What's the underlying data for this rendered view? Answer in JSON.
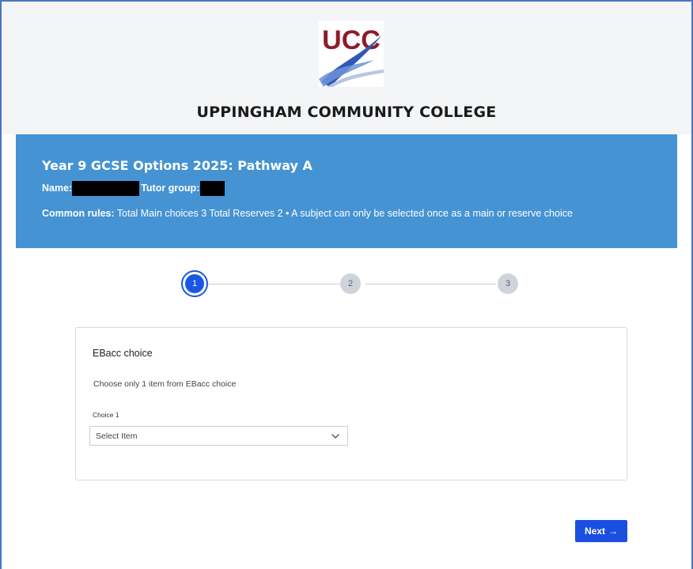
{
  "header": {
    "logo_text": "UCC",
    "college_name": "UPPINGHAM COMMUNITY COLLEGE"
  },
  "banner": {
    "title": "Year 9 GCSE Options 2025: Pathway A",
    "name_label": "Name:",
    "tutor_label": "Tutor group:",
    "rules_label": "Common rules:",
    "rules_text": " Total Main choices 3 Total Reserves 2 • A subject can only be selected once as a main or reserve choice"
  },
  "stepper": {
    "steps": [
      "1",
      "2",
      "3"
    ],
    "current": 1
  },
  "card": {
    "title": "EBacc choice",
    "help_text": "Choose only 1 item from EBacc choice",
    "field_label": "Choice 1",
    "select_value": "Select Item"
  },
  "actions": {
    "next_label": "Next",
    "next_icon": "→"
  },
  "colors": {
    "banner": "#4593d3",
    "accent": "#1b4fe0",
    "logo_red": "#8e1b2b",
    "logo_blue": "#2f59b6"
  }
}
